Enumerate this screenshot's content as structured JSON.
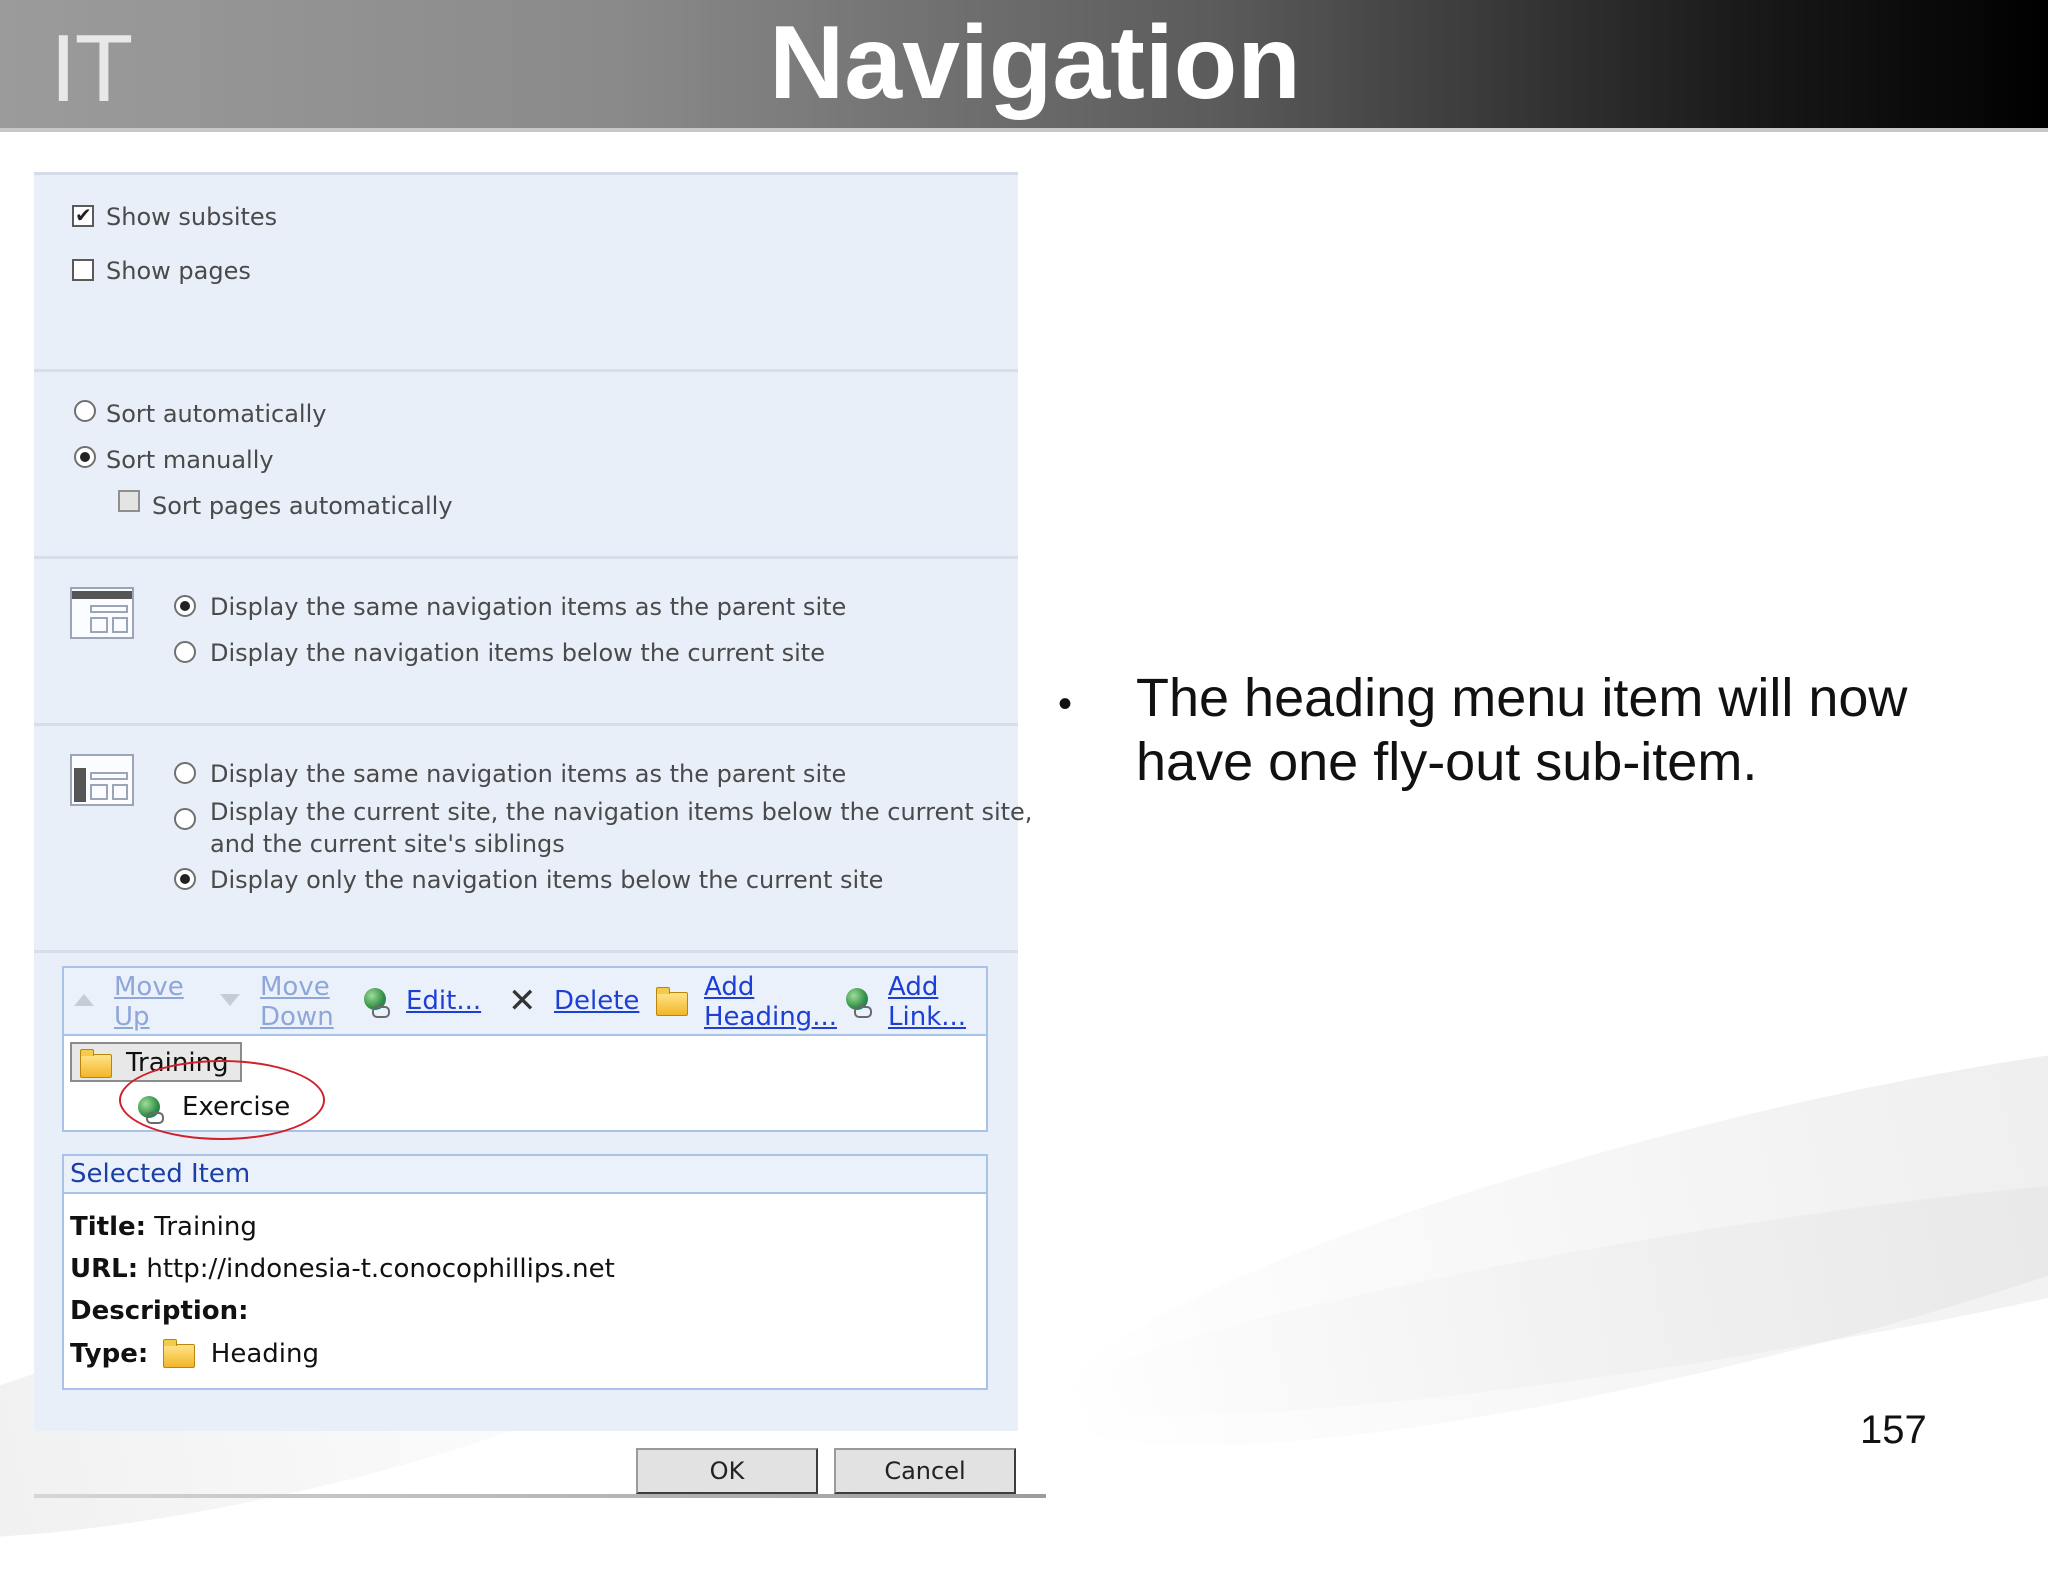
{
  "slide": {
    "logo": "IT",
    "title": "Navigation",
    "bullet": "The heading menu item will now have one fly-out sub-item.",
    "page_number": "157"
  },
  "options": {
    "show_subsites": {
      "label": "Show subsites",
      "checked": true
    },
    "show_pages": {
      "label": "Show pages",
      "checked": false
    },
    "sort_automatically": {
      "label": "Sort automatically",
      "selected": false
    },
    "sort_manually": {
      "label": "Sort manually",
      "selected": true
    },
    "sort_pages_automatically": {
      "label": "Sort pages automatically",
      "checked": false,
      "disabled": true
    }
  },
  "global_nav": {
    "icon": "global-navigation-icon",
    "same_as_parent": {
      "label": "Display the same navigation items as the parent site",
      "selected": true
    },
    "below_current": {
      "label": "Display the navigation items below the current site",
      "selected": false
    }
  },
  "current_nav": {
    "icon": "current-navigation-icon",
    "same_as_parent": {
      "label": "Display the same navigation items as the parent site",
      "selected": false
    },
    "current_and_siblings_line1": "Display the current site, the navigation items below the current site,",
    "current_and_siblings_line2": "and the current site's siblings",
    "only_below": {
      "label": "Display only the navigation items below the current site",
      "selected": true
    }
  },
  "toolbar": {
    "move_up_1": "Move",
    "move_up_2": "Up",
    "move_down_1": "Move",
    "move_down_2": "Down",
    "edit": "Edit...",
    "delete": "Delete",
    "add_heading_1": "Add",
    "add_heading_2": "Heading...",
    "add_link_1": "Add",
    "add_link_2": "Link..."
  },
  "tree": {
    "heading": "Training",
    "child": "Exercise"
  },
  "selected_item": {
    "header": "Selected Item",
    "title_label": "Title:",
    "title_value": "Training",
    "url_label": "URL:",
    "url_value": "http://indonesia-t.conocophillips.net",
    "description_label": "Description:",
    "type_label": "Type:",
    "type_value": "Heading"
  },
  "buttons": {
    "ok": "OK",
    "cancel": "Cancel"
  },
  "colors": {
    "panel_bg": "#e9eff9",
    "link_blue": "#1d3fd6",
    "highlight_red": "#d0202a"
  }
}
